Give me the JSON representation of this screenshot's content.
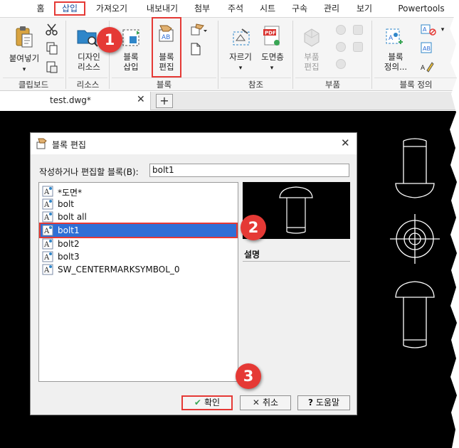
{
  "menu_tabs": [
    {
      "label": "홈",
      "active": false
    },
    {
      "label": "삽입",
      "active": true
    },
    {
      "label": "가져오기",
      "active": false
    },
    {
      "label": "내보내기",
      "active": false
    },
    {
      "label": "첨부",
      "active": false
    },
    {
      "label": "주석",
      "active": false
    },
    {
      "label": "시트",
      "active": false
    },
    {
      "label": "구속",
      "active": false
    },
    {
      "label": "관리",
      "active": false
    },
    {
      "label": "보기",
      "active": false
    },
    {
      "label": "Powertools",
      "active": false
    }
  ],
  "ribbon": {
    "paste": "붙여넣기",
    "design_resources": "디자인\n리소스",
    "block_insert": "블록\n삽입",
    "block_edit": "블록\n편집",
    "clip": "자르기",
    "drawing_layer": "도면층",
    "part_edit": "부품\n편집",
    "block_define": "블록\n정의...",
    "groups": {
      "clipboard": "클립보드",
      "resources": "리소스",
      "block": "블록",
      "reference": "참조",
      "part": "부품",
      "block_definition": "블록 정의"
    }
  },
  "doc_tabs": {
    "active_file": "test.dwg*",
    "close_glyph": "✕",
    "new_glyph": "+"
  },
  "dialog": {
    "title": "블록 편집",
    "close_glyph": "✕",
    "field_label": "작성하거나 편집할 블록(B):",
    "field_value": "bolt1",
    "list_items": [
      {
        "label": "*도면*",
        "selected": false
      },
      {
        "label": "bolt",
        "selected": false
      },
      {
        "label": "bolt all",
        "selected": false
      },
      {
        "label": "bolt1",
        "selected": true
      },
      {
        "label": "bolt2",
        "selected": false
      },
      {
        "label": "bolt3",
        "selected": false
      },
      {
        "label": "SW_CENTERMARKSYMBOL_0",
        "selected": false
      }
    ],
    "description_label": "설명",
    "buttons": {
      "ok": "확인",
      "cancel": "취소",
      "help": "도움말"
    }
  },
  "callouts": [
    "1",
    "2",
    "3"
  ],
  "colors": {
    "accent_red": "#e53935",
    "selection_blue": "#2f6fd6",
    "canvas": "#000000"
  }
}
